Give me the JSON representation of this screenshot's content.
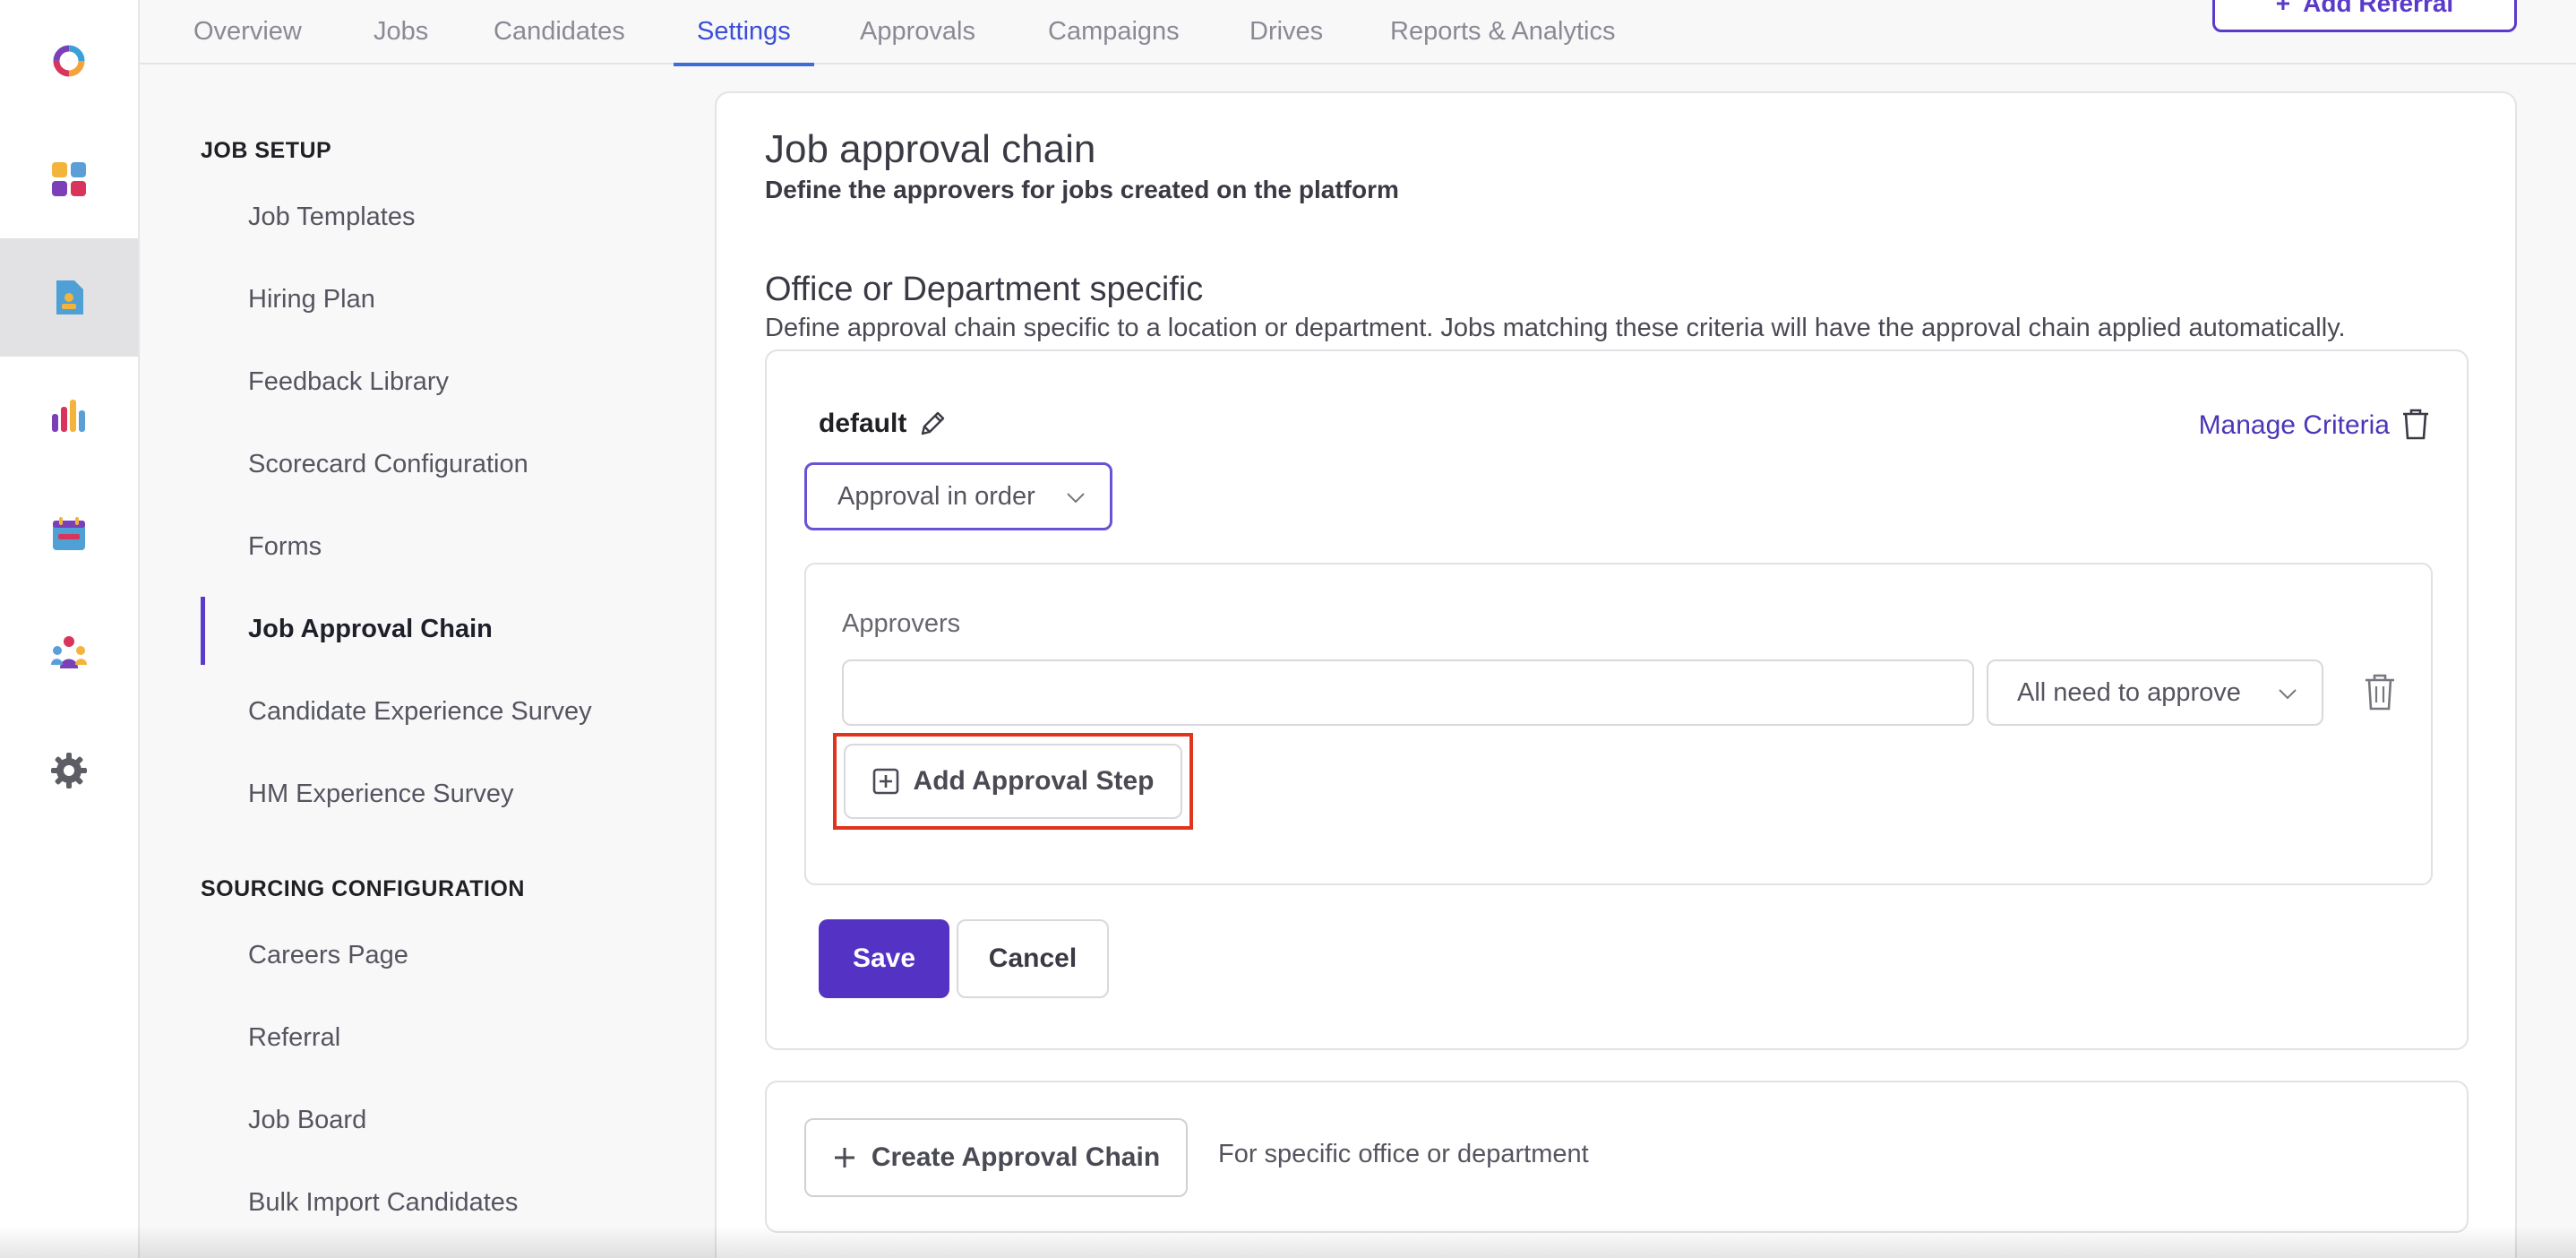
{
  "top_nav": {
    "tabs": [
      {
        "label": "Overview",
        "active": false
      },
      {
        "label": "Jobs",
        "active": false
      },
      {
        "label": "Candidates",
        "active": false
      },
      {
        "label": "Settings",
        "active": true
      },
      {
        "label": "Approvals",
        "active": false
      },
      {
        "label": "Campaigns",
        "active": false
      },
      {
        "label": "Drives",
        "active": false
      },
      {
        "label": "Reports & Analytics",
        "active": false
      }
    ],
    "add_referral_label": "Add Referral"
  },
  "left_rail": {
    "icons": [
      "logo-ring-icon",
      "apps-grid-icon",
      "job-document-icon",
      "analytics-bars-icon",
      "calendar-icon",
      "team-icon",
      "settings-gear-icon"
    ],
    "active_index": 2
  },
  "settings_menu": {
    "sections": [
      {
        "title": "JOB SETUP",
        "items": [
          {
            "label": "Job Templates"
          },
          {
            "label": "Hiring Plan"
          },
          {
            "label": "Feedback Library"
          },
          {
            "label": "Scorecard Configuration"
          },
          {
            "label": "Forms"
          },
          {
            "label": "Job Approval Chain",
            "active": true
          },
          {
            "label": "Candidate Experience Survey"
          },
          {
            "label": "HM Experience Survey"
          }
        ]
      },
      {
        "title": "SOURCING CONFIGURATION",
        "items": [
          {
            "label": "Careers Page"
          },
          {
            "label": "Referral"
          },
          {
            "label": "Job Board"
          },
          {
            "label": "Bulk Import Candidates"
          }
        ]
      }
    ]
  },
  "main": {
    "title": "Job approval chain",
    "subtitle": "Define the approvers for jobs created on the platform",
    "section_title": "Office or Department specific",
    "section_desc": "Define approval chain specific to a location or department. Jobs matching these criteria will have the approval chain applied automatically.",
    "chain": {
      "name": "default",
      "manage_criteria_label": "Manage Criteria",
      "order_select_value": "Approval in order",
      "approvers_label": "Approvers",
      "approver_input_value": "",
      "approve_rule_value": "All need to approve",
      "add_step_label": "Add Approval Step",
      "save_label": "Save",
      "cancel_label": "Cancel"
    },
    "create": {
      "button_label": "Create Approval Chain",
      "desc": "For specific office or department"
    }
  },
  "colors": {
    "brand_purple": "#5432c4",
    "active_tab_blue": "#3c4fd6",
    "highlight_red": "#e0341c"
  }
}
